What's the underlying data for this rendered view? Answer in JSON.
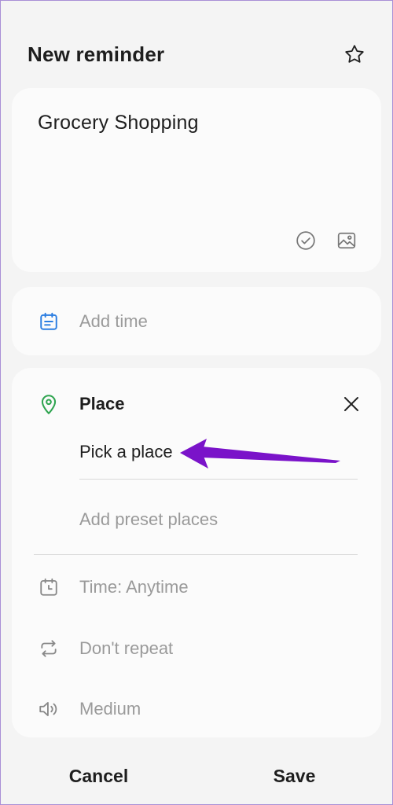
{
  "header": {
    "title": "New reminder",
    "star_icon": "star-outline-icon"
  },
  "reminder": {
    "title": "Grocery Shopping",
    "actions": [
      {
        "name": "check-circle-icon"
      },
      {
        "name": "image-icon"
      }
    ]
  },
  "time_row": {
    "label": "Add time",
    "icon": "calendar-icon",
    "icon_color": "#2a7de1"
  },
  "place": {
    "header_label": "Place",
    "icon": "location-pin-icon",
    "icon_color": "#2ea44f",
    "pick_label": "Pick a place",
    "preset_label": "Add preset places",
    "time_label": "Time: Anytime",
    "repeat_label": "Don't repeat",
    "volume_label": "Medium"
  },
  "annotation": {
    "arrow_color": "#7a13c9"
  },
  "footer": {
    "cancel_label": "Cancel",
    "save_label": "Save"
  }
}
